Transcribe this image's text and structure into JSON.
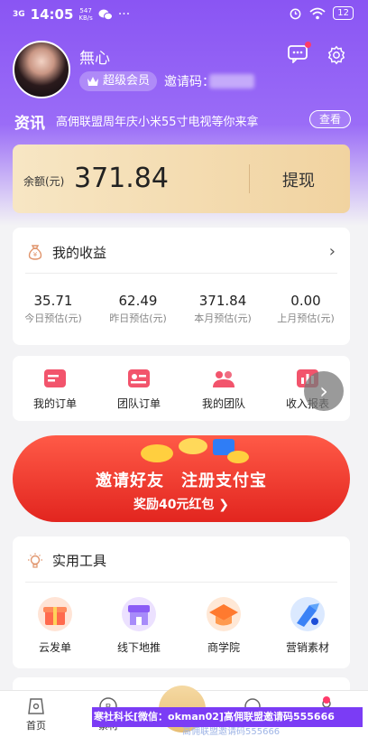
{
  "status_bar": {
    "signal": "3G",
    "time": "14:05",
    "net_speed": "547",
    "net_unit": "KB/s",
    "dots": "···",
    "battery": "12"
  },
  "profile": {
    "name": "無心",
    "vip_label": "超级会员",
    "invite_label": "邀请码："
  },
  "news": {
    "tag": "资讯",
    "text": "高佣联盟周年庆小米55寸电视等你来拿",
    "button": "查看"
  },
  "balance": {
    "label": "余额(元)",
    "value": "371.84",
    "withdraw": "提现"
  },
  "earnings": {
    "title": "我的收益",
    "arrow": "›",
    "stats": [
      {
        "value": "35.71",
        "label": "今日预估(元)"
      },
      {
        "value": "62.49",
        "label": "昨日预估(元)"
      },
      {
        "value": "371.84",
        "label": "本月预估(元)"
      },
      {
        "value": "0.00",
        "label": "上月预估(元)"
      }
    ]
  },
  "menu": {
    "items": [
      {
        "label": "我的订单",
        "icon": "order-icon"
      },
      {
        "label": "团队订单",
        "icon": "team-order-icon"
      },
      {
        "label": "我的团队",
        "icon": "team-icon"
      },
      {
        "label": "收入报表",
        "icon": "report-icon"
      }
    ],
    "scroll_glyph": "›"
  },
  "banner": {
    "line1": "邀请好友　注册支付宝",
    "line2": "奖励40元红包 ❯"
  },
  "tools": {
    "title": "实用工具",
    "items": [
      {
        "label": "云发单",
        "icon": "gift-icon"
      },
      {
        "label": "线下地推",
        "icon": "shop-icon"
      },
      {
        "label": "商学院",
        "icon": "academy-icon"
      },
      {
        "label": "营销素材",
        "icon": "material-icon"
      }
    ]
  },
  "tabbar": {
    "home": "首页",
    "second": "素材"
  },
  "watermark": {
    "text": "寒社科长[微信：okman02]高佣联盟邀请码555666",
    "sub": "高佣联盟邀请码555666"
  },
  "colors": {
    "header": "#8a55f3",
    "balance_card": "#f1d3a0",
    "banner": "#e2251f",
    "watermark": "#7b3cf5"
  }
}
